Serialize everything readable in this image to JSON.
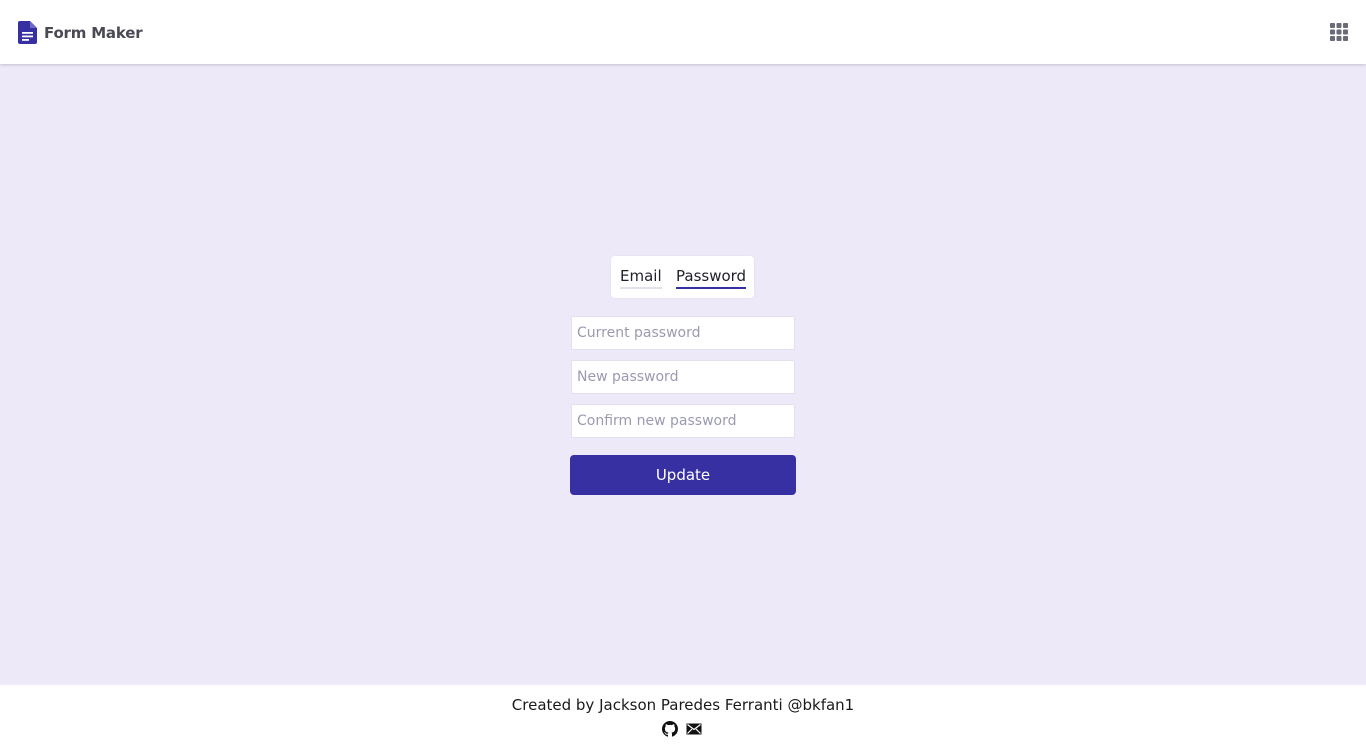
{
  "header": {
    "app_title": "Form Maker",
    "logo_icon": "document-icon",
    "apps_icon": "apps-grid-icon"
  },
  "tabs": [
    {
      "label": "Email",
      "active": false
    },
    {
      "label": "Password",
      "active": true
    }
  ],
  "form": {
    "current_password": {
      "value": "",
      "placeholder": "Current password"
    },
    "new_password": {
      "value": "",
      "placeholder": "New password"
    },
    "confirm_password": {
      "value": "",
      "placeholder": "Confirm new password"
    },
    "submit_label": "Update"
  },
  "footer": {
    "credit": "Created by Jackson Paredes Ferranti @bkfan1",
    "icons": [
      "github-icon",
      "mail-icon"
    ]
  },
  "colors": {
    "accent": "#3730a3",
    "background": "#ede9f8",
    "surface": "#ffffff"
  }
}
